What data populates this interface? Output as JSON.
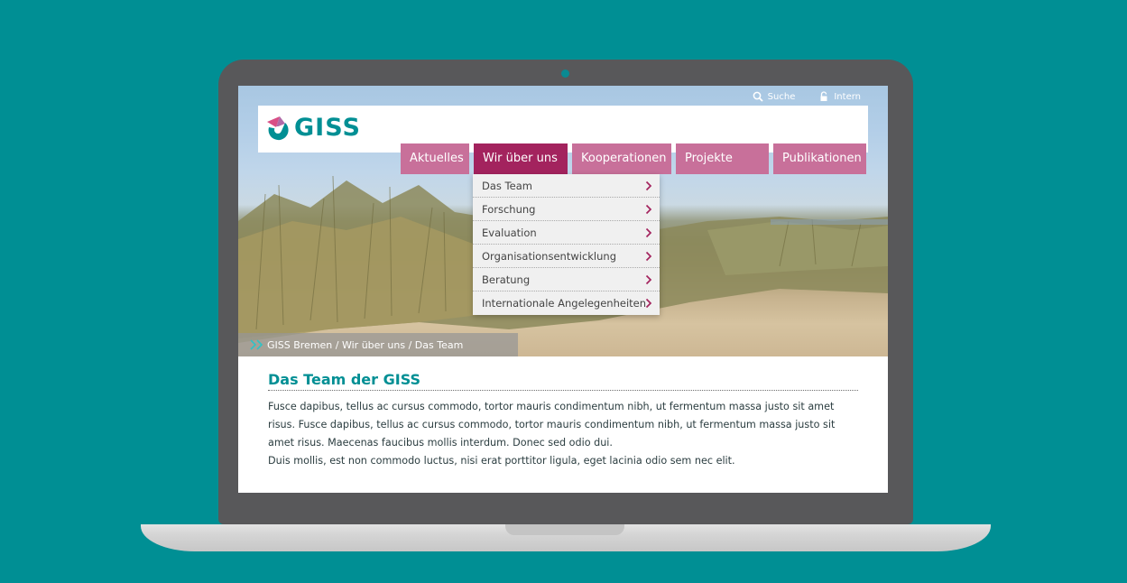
{
  "top_links": {
    "search_label": "Suche",
    "intern_label": "Intern"
  },
  "logo": {
    "text": "GISS"
  },
  "nav": {
    "items": [
      {
        "label": "Aktuelles"
      },
      {
        "label": "Wir über uns"
      },
      {
        "label": "Kooperationen"
      },
      {
        "label": "Projekte"
      },
      {
        "label": "Publikationen"
      }
    ],
    "active_item": "Wir über uns"
  },
  "dropdown": {
    "items": [
      {
        "label": "Das Team"
      },
      {
        "label": "Forschung"
      },
      {
        "label": "Evaluation"
      },
      {
        "label": "Organisationsentwicklung"
      },
      {
        "label": "Beratung"
      },
      {
        "label": "Internationale Angelegenheiten"
      }
    ]
  },
  "breadcrumb": {
    "text": "GISS Bremen / Wir über uns / Das Team"
  },
  "main": {
    "title": "Das Team der GISS",
    "paragraph_1": "Fusce dapibus, tellus ac cursus commodo, tortor mauris condimentum nibh, ut fermentum massa justo sit amet risus. Fusce dapibus, tellus ac cursus commodo, tortor mauris condimentum nibh, ut fermentum massa justo sit amet risus. Maecenas faucibus mollis interdum. Donec sed odio dui.",
    "paragraph_2": "Duis mollis, est non commodo luctus, nisi erat porttitor ligula, eget lacinia odio sem nec elit."
  },
  "colors": {
    "background": "#008f94",
    "brand_teal": "#008f94",
    "nav_pink": "#c8709a",
    "nav_active": "#a3235e",
    "chevron": "#a3235e"
  },
  "icons": {
    "search": "magnifier-icon",
    "intern": "lock-icon",
    "dropdown_item": "chevron-right-icon",
    "breadcrumb": "double-chevron-right-icon"
  }
}
